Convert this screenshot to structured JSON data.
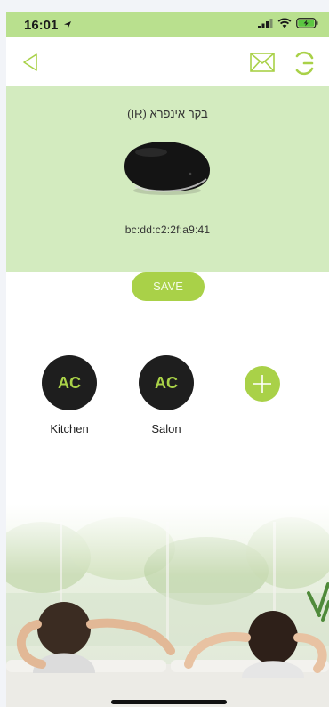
{
  "status_bar": {
    "time": "16:01"
  },
  "device": {
    "name": "בקר אינפרא (IR)",
    "mac": "bc:dd:c2:2f:a9:41"
  },
  "actions": {
    "save_label": "SAVE"
  },
  "remotes": [
    {
      "icon_text": "AC",
      "label": "Kitchen"
    },
    {
      "icon_text": "AC",
      "label": "Salon"
    }
  ],
  "colors": {
    "accent": "#a9d148",
    "status_bar": "#b9e08e",
    "panel": "#d3ebbf"
  }
}
